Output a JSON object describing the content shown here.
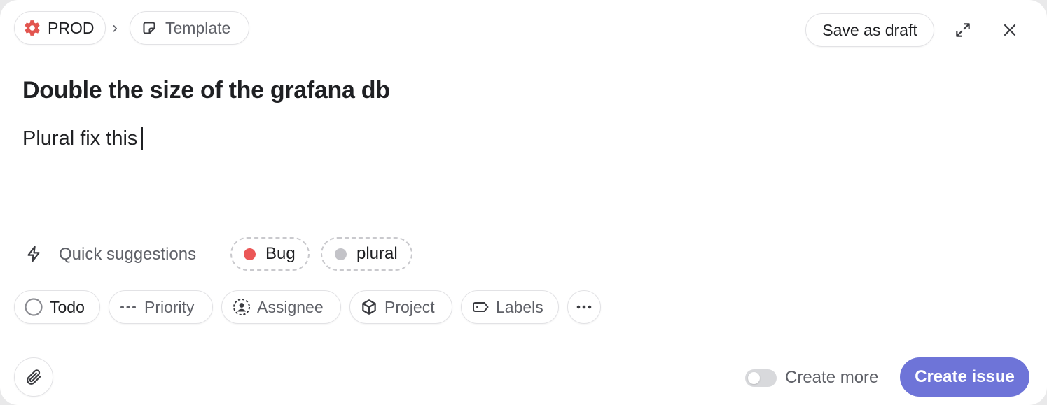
{
  "header": {
    "team_label": "PROD",
    "team_icon": "gear-icon",
    "breadcrumb_separator": "›",
    "template_label": "Template",
    "template_icon": "sticky-note-icon",
    "save_draft_label": "Save as draft",
    "expand_icon": "expand-icon",
    "close_icon": "close-icon"
  },
  "issue": {
    "title": "Double the size of the grafana db",
    "description": "Plural fix this"
  },
  "suggestions": {
    "label": "Quick suggestions",
    "icon": "lightning-icon",
    "items": [
      {
        "label": "Bug",
        "color": "#eb5757"
      },
      {
        "label": "plural",
        "color": "#c3c3c8"
      }
    ]
  },
  "properties": {
    "status": {
      "label": "Todo",
      "icon": "circle-icon"
    },
    "priority": {
      "label": "Priority",
      "icon": "dashes-icon"
    },
    "assignee": {
      "label": "Assignee",
      "icon": "user-circle-icon"
    },
    "project": {
      "label": "Project",
      "icon": "cube-icon"
    },
    "labels": {
      "label": "Labels",
      "icon": "tag-icon"
    },
    "more": {
      "label": "•••",
      "icon": "more-icon"
    }
  },
  "footer": {
    "attach_icon": "paperclip-icon",
    "create_more_label": "Create more",
    "create_more_enabled": false,
    "create_label": "Create issue",
    "accent_color": "#6e74d8"
  }
}
